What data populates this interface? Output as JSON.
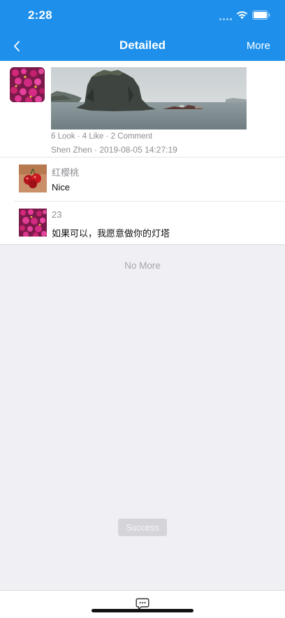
{
  "status": {
    "time": "2:28"
  },
  "nav": {
    "title": "Detailed",
    "more_label": "More"
  },
  "post": {
    "stats": "6 Look · 4 Like · 2 Comment",
    "meta": "Shen Zhen · 2019-08-05 14:27:19"
  },
  "comments": [
    {
      "author": "红樱桃",
      "text": "Nice"
    },
    {
      "author": "23",
      "text": "如果可以，我愿意做你的灯塔"
    }
  ],
  "footer": {
    "no_more": "No More"
  },
  "toast": {
    "text": "Success"
  },
  "colors": {
    "accent": "#1e90ec",
    "background": "#efeff4"
  },
  "icons": {
    "back": "chevron-left-icon",
    "comment": "comment-bubble-icon",
    "wifi": "wifi-icon",
    "battery": "battery-icon",
    "signal": "cellular-signal-icon"
  }
}
